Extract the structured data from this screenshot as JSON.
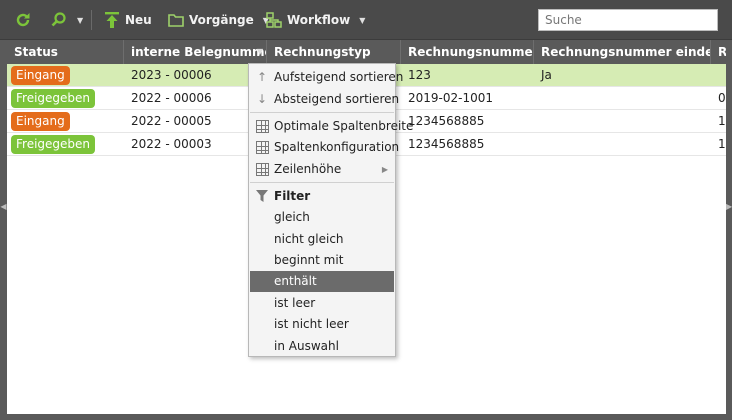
{
  "toolbar": {
    "refresh_icon": "refresh-icon",
    "search_icon": "magnifier-icon",
    "new_label": "Neu",
    "processes_label": "Vorgänge",
    "workflow_label": "Workflow",
    "search_placeholder": "Suche"
  },
  "colors": {
    "toolbar_bg": "#4a4a4a",
    "header_bg": "#5a5a5a",
    "selected_row": "#d6ecb4",
    "badge_eingang": "#e46c1b",
    "badge_freigegeben": "#7cc43a",
    "icon_green": "#7cc43a",
    "menu_highlight": "#6b6b6b"
  },
  "grid": {
    "columns": [
      "Status",
      "interne Belegnummer",
      "Rechnungstyp",
      "Rechnungsnummer",
      "Rechnungsnummer einde...",
      "R"
    ],
    "rows": [
      {
        "status": "Eingang",
        "status_color": "orange",
        "beleg": "2023 - 00006",
        "typ": "",
        "nummer": "123",
        "eindeutig": "Ja",
        "extra": "",
        "selected": true
      },
      {
        "status": "Freigegeben",
        "status_color": "green",
        "beleg": "2022 - 00006",
        "typ": "",
        "nummer": "2019-02-1001",
        "eindeutig": "",
        "extra": "0"
      },
      {
        "status": "Eingang",
        "status_color": "orange",
        "beleg": "2022 - 00005",
        "typ": "",
        "nummer": "1234568885",
        "eindeutig": "",
        "extra": "1"
      },
      {
        "status": "Freigegeben",
        "status_color": "green",
        "beleg": "2022 - 00003",
        "typ": "",
        "nummer": "1234568885",
        "eindeutig": "",
        "extra": "1"
      }
    ]
  },
  "context_menu": {
    "sort_asc": "Aufsteigend sortieren",
    "sort_desc": "Absteigend sortieren",
    "optimal_width": "Optimale Spaltenbreite",
    "column_config": "Spaltenkonfiguration",
    "row_height": "Zeilenhöhe",
    "filter_title": "Filter",
    "filter_options": [
      "gleich",
      "nicht gleich",
      "beginnt mit",
      "enthält",
      "ist leer",
      "ist nicht leer",
      "in Auswahl"
    ],
    "highlighted_option": "enthält"
  }
}
